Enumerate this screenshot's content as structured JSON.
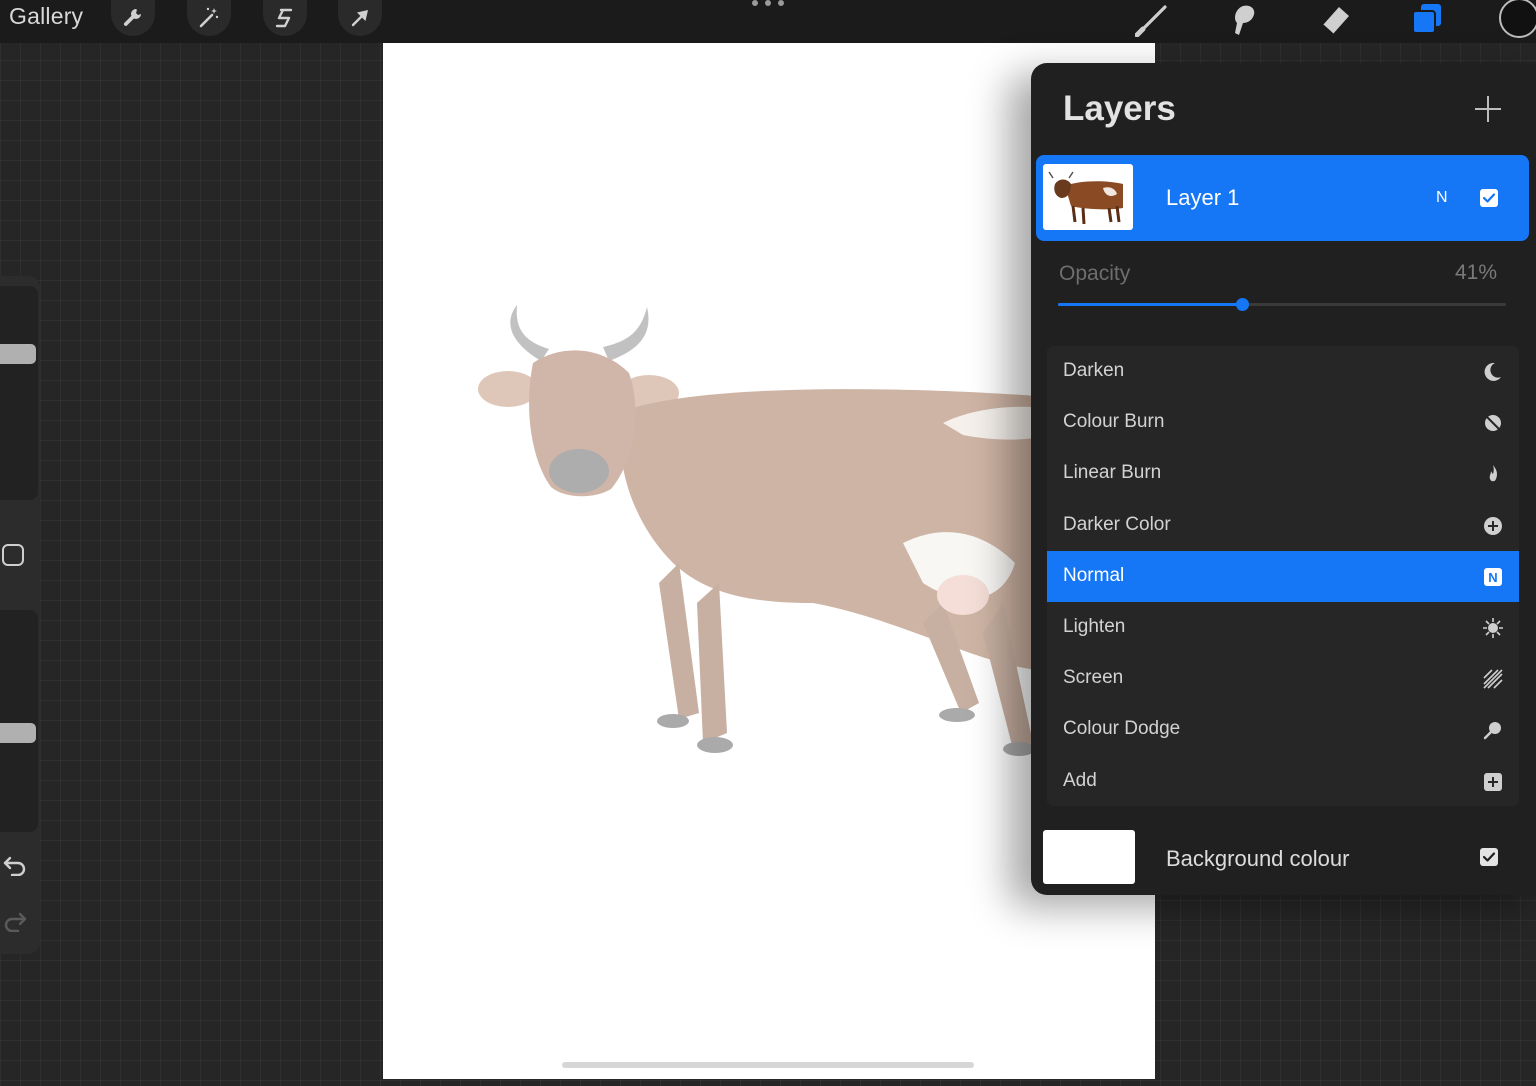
{
  "topbar": {
    "gallery_label": "Gallery",
    "left_tools": [
      {
        "icon": "wrench-icon",
        "name": "actions"
      },
      {
        "icon": "magic-wand-icon",
        "name": "adjustments"
      },
      {
        "icon": "selection-icon",
        "name": "selection"
      },
      {
        "icon": "arrow-cursor-icon",
        "name": "transform"
      }
    ],
    "right_tools": [
      {
        "icon": "brush-icon",
        "name": "brush"
      },
      {
        "icon": "smudge-icon",
        "name": "smudge"
      },
      {
        "icon": "eraser-icon",
        "name": "eraser"
      },
      {
        "icon": "layers-icon",
        "name": "layers"
      }
    ],
    "active_tool": "layers",
    "current_color": "#111111"
  },
  "layers_panel": {
    "title": "Layers",
    "layer": {
      "name": "Layer 1",
      "blend_code": "N",
      "visible": true
    },
    "opacity": {
      "label": "Opacity",
      "value_text": "41%",
      "value": 0.41
    },
    "blend_modes": [
      {
        "label": "Darken",
        "icon": "moon-icon",
        "selected": false
      },
      {
        "label": "Colour Burn",
        "icon": "burn-icon",
        "selected": false
      },
      {
        "label": "Linear Burn",
        "icon": "flame-icon",
        "selected": false
      },
      {
        "label": "Darker Color",
        "icon": "plus-circle-icon",
        "selected": false
      },
      {
        "label": "Normal",
        "icon": "n-badge-icon",
        "badge": "N",
        "selected": true
      },
      {
        "label": "Lighten",
        "icon": "sun-icon",
        "selected": false
      },
      {
        "label": "Screen",
        "icon": "hatch-icon",
        "selected": false
      },
      {
        "label": "Colour Dodge",
        "icon": "dodge-icon",
        "selected": false
      },
      {
        "label": "Add",
        "icon": "plus-square-icon",
        "selected": false
      }
    ],
    "background": {
      "label": "Background colour",
      "visible": true,
      "color": "#ffffff"
    }
  },
  "colors": {
    "accent": "#1577f5",
    "panel": "#202020",
    "canvas": "#ffffff"
  }
}
